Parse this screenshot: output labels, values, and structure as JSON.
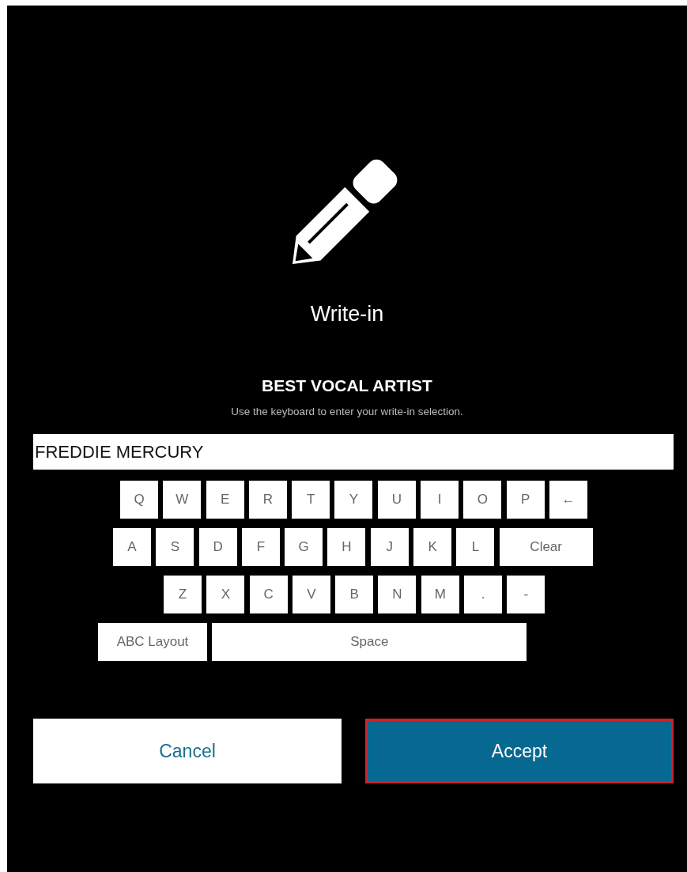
{
  "dialog": {
    "title": "Write-in",
    "contest": "BEST VOCAL ARTIST",
    "instructions": "Use the keyboard to enter your write-in selection."
  },
  "write_in_field": {
    "value": "FREDDIE MERCURY"
  },
  "keyboard": {
    "rows": [
      {
        "keys": [
          {
            "label": "Q",
            "kind": "char"
          },
          {
            "label": "W",
            "kind": "char"
          },
          {
            "label": "E",
            "kind": "char"
          },
          {
            "label": "R",
            "kind": "char"
          },
          {
            "label": "T",
            "kind": "char"
          },
          {
            "label": "Y",
            "kind": "char"
          },
          {
            "label": "U",
            "kind": "char"
          },
          {
            "label": "I",
            "kind": "char"
          },
          {
            "label": "O",
            "kind": "char"
          },
          {
            "label": "P",
            "kind": "char"
          },
          {
            "label": "←",
            "kind": "char"
          }
        ]
      },
      {
        "keys": [
          {
            "label": "A",
            "kind": "char"
          },
          {
            "label": "S",
            "kind": "char"
          },
          {
            "label": "D",
            "kind": "char"
          },
          {
            "label": "F",
            "kind": "char"
          },
          {
            "label": "G",
            "kind": "char"
          },
          {
            "label": "H",
            "kind": "char"
          },
          {
            "label": "J",
            "kind": "char"
          },
          {
            "label": "K",
            "kind": "char"
          },
          {
            "label": "L",
            "kind": "char"
          },
          {
            "label": "Clear",
            "kind": "clear"
          }
        ]
      },
      {
        "keys": [
          {
            "label": "Z",
            "kind": "char"
          },
          {
            "label": "X",
            "kind": "char"
          },
          {
            "label": "C",
            "kind": "char"
          },
          {
            "label": "V",
            "kind": "char"
          },
          {
            "label": "B",
            "kind": "char"
          },
          {
            "label": "N",
            "kind": "char"
          },
          {
            "label": "M",
            "kind": "char"
          },
          {
            "label": ".",
            "kind": "char"
          },
          {
            "label": "-",
            "kind": "char"
          }
        ]
      },
      {
        "keys": [
          {
            "label": "ABC Layout",
            "kind": "layout"
          },
          {
            "label": "Space",
            "kind": "space"
          }
        ]
      }
    ]
  },
  "buttons": [
    {
      "label": "Cancel",
      "kind": "secondary",
      "selected": false
    },
    {
      "label": "Accept",
      "kind": "primary",
      "selected": true
    }
  ]
}
